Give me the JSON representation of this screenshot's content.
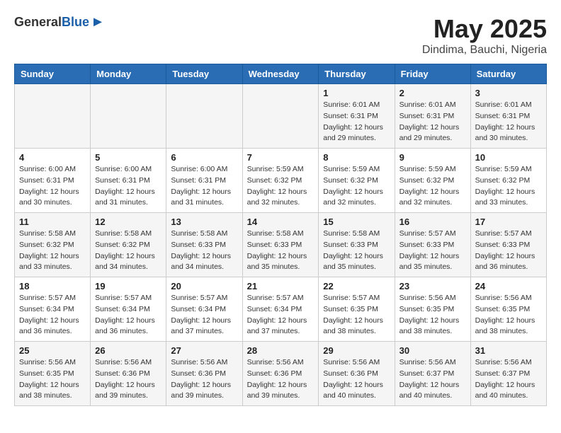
{
  "header": {
    "logo_general": "General",
    "logo_blue": "Blue",
    "month_title": "May 2025",
    "location": "Dindima, Bauchi, Nigeria"
  },
  "weekdays": [
    "Sunday",
    "Monday",
    "Tuesday",
    "Wednesday",
    "Thursday",
    "Friday",
    "Saturday"
  ],
  "weeks": [
    [
      {
        "day": "",
        "info": ""
      },
      {
        "day": "",
        "info": ""
      },
      {
        "day": "",
        "info": ""
      },
      {
        "day": "",
        "info": ""
      },
      {
        "day": "1",
        "info": "Sunrise: 6:01 AM\nSunset: 6:31 PM\nDaylight: 12 hours\nand 29 minutes."
      },
      {
        "day": "2",
        "info": "Sunrise: 6:01 AM\nSunset: 6:31 PM\nDaylight: 12 hours\nand 29 minutes."
      },
      {
        "day": "3",
        "info": "Sunrise: 6:01 AM\nSunset: 6:31 PM\nDaylight: 12 hours\nand 30 minutes."
      }
    ],
    [
      {
        "day": "4",
        "info": "Sunrise: 6:00 AM\nSunset: 6:31 PM\nDaylight: 12 hours\nand 30 minutes."
      },
      {
        "day": "5",
        "info": "Sunrise: 6:00 AM\nSunset: 6:31 PM\nDaylight: 12 hours\nand 31 minutes."
      },
      {
        "day": "6",
        "info": "Sunrise: 6:00 AM\nSunset: 6:31 PM\nDaylight: 12 hours\nand 31 minutes."
      },
      {
        "day": "7",
        "info": "Sunrise: 5:59 AM\nSunset: 6:32 PM\nDaylight: 12 hours\nand 32 minutes."
      },
      {
        "day": "8",
        "info": "Sunrise: 5:59 AM\nSunset: 6:32 PM\nDaylight: 12 hours\nand 32 minutes."
      },
      {
        "day": "9",
        "info": "Sunrise: 5:59 AM\nSunset: 6:32 PM\nDaylight: 12 hours\nand 32 minutes."
      },
      {
        "day": "10",
        "info": "Sunrise: 5:59 AM\nSunset: 6:32 PM\nDaylight: 12 hours\nand 33 minutes."
      }
    ],
    [
      {
        "day": "11",
        "info": "Sunrise: 5:58 AM\nSunset: 6:32 PM\nDaylight: 12 hours\nand 33 minutes."
      },
      {
        "day": "12",
        "info": "Sunrise: 5:58 AM\nSunset: 6:32 PM\nDaylight: 12 hours\nand 34 minutes."
      },
      {
        "day": "13",
        "info": "Sunrise: 5:58 AM\nSunset: 6:33 PM\nDaylight: 12 hours\nand 34 minutes."
      },
      {
        "day": "14",
        "info": "Sunrise: 5:58 AM\nSunset: 6:33 PM\nDaylight: 12 hours\nand 35 minutes."
      },
      {
        "day": "15",
        "info": "Sunrise: 5:58 AM\nSunset: 6:33 PM\nDaylight: 12 hours\nand 35 minutes."
      },
      {
        "day": "16",
        "info": "Sunrise: 5:57 AM\nSunset: 6:33 PM\nDaylight: 12 hours\nand 35 minutes."
      },
      {
        "day": "17",
        "info": "Sunrise: 5:57 AM\nSunset: 6:33 PM\nDaylight: 12 hours\nand 36 minutes."
      }
    ],
    [
      {
        "day": "18",
        "info": "Sunrise: 5:57 AM\nSunset: 6:34 PM\nDaylight: 12 hours\nand 36 minutes."
      },
      {
        "day": "19",
        "info": "Sunrise: 5:57 AM\nSunset: 6:34 PM\nDaylight: 12 hours\nand 36 minutes."
      },
      {
        "day": "20",
        "info": "Sunrise: 5:57 AM\nSunset: 6:34 PM\nDaylight: 12 hours\nand 37 minutes."
      },
      {
        "day": "21",
        "info": "Sunrise: 5:57 AM\nSunset: 6:34 PM\nDaylight: 12 hours\nand 37 minutes."
      },
      {
        "day": "22",
        "info": "Sunrise: 5:57 AM\nSunset: 6:35 PM\nDaylight: 12 hours\nand 38 minutes."
      },
      {
        "day": "23",
        "info": "Sunrise: 5:56 AM\nSunset: 6:35 PM\nDaylight: 12 hours\nand 38 minutes."
      },
      {
        "day": "24",
        "info": "Sunrise: 5:56 AM\nSunset: 6:35 PM\nDaylight: 12 hours\nand 38 minutes."
      }
    ],
    [
      {
        "day": "25",
        "info": "Sunrise: 5:56 AM\nSunset: 6:35 PM\nDaylight: 12 hours\nand 38 minutes."
      },
      {
        "day": "26",
        "info": "Sunrise: 5:56 AM\nSunset: 6:36 PM\nDaylight: 12 hours\nand 39 minutes."
      },
      {
        "day": "27",
        "info": "Sunrise: 5:56 AM\nSunset: 6:36 PM\nDaylight: 12 hours\nand 39 minutes."
      },
      {
        "day": "28",
        "info": "Sunrise: 5:56 AM\nSunset: 6:36 PM\nDaylight: 12 hours\nand 39 minutes."
      },
      {
        "day": "29",
        "info": "Sunrise: 5:56 AM\nSunset: 6:36 PM\nDaylight: 12 hours\nand 40 minutes."
      },
      {
        "day": "30",
        "info": "Sunrise: 5:56 AM\nSunset: 6:37 PM\nDaylight: 12 hours\nand 40 minutes."
      },
      {
        "day": "31",
        "info": "Sunrise: 5:56 AM\nSunset: 6:37 PM\nDaylight: 12 hours\nand 40 minutes."
      }
    ]
  ]
}
